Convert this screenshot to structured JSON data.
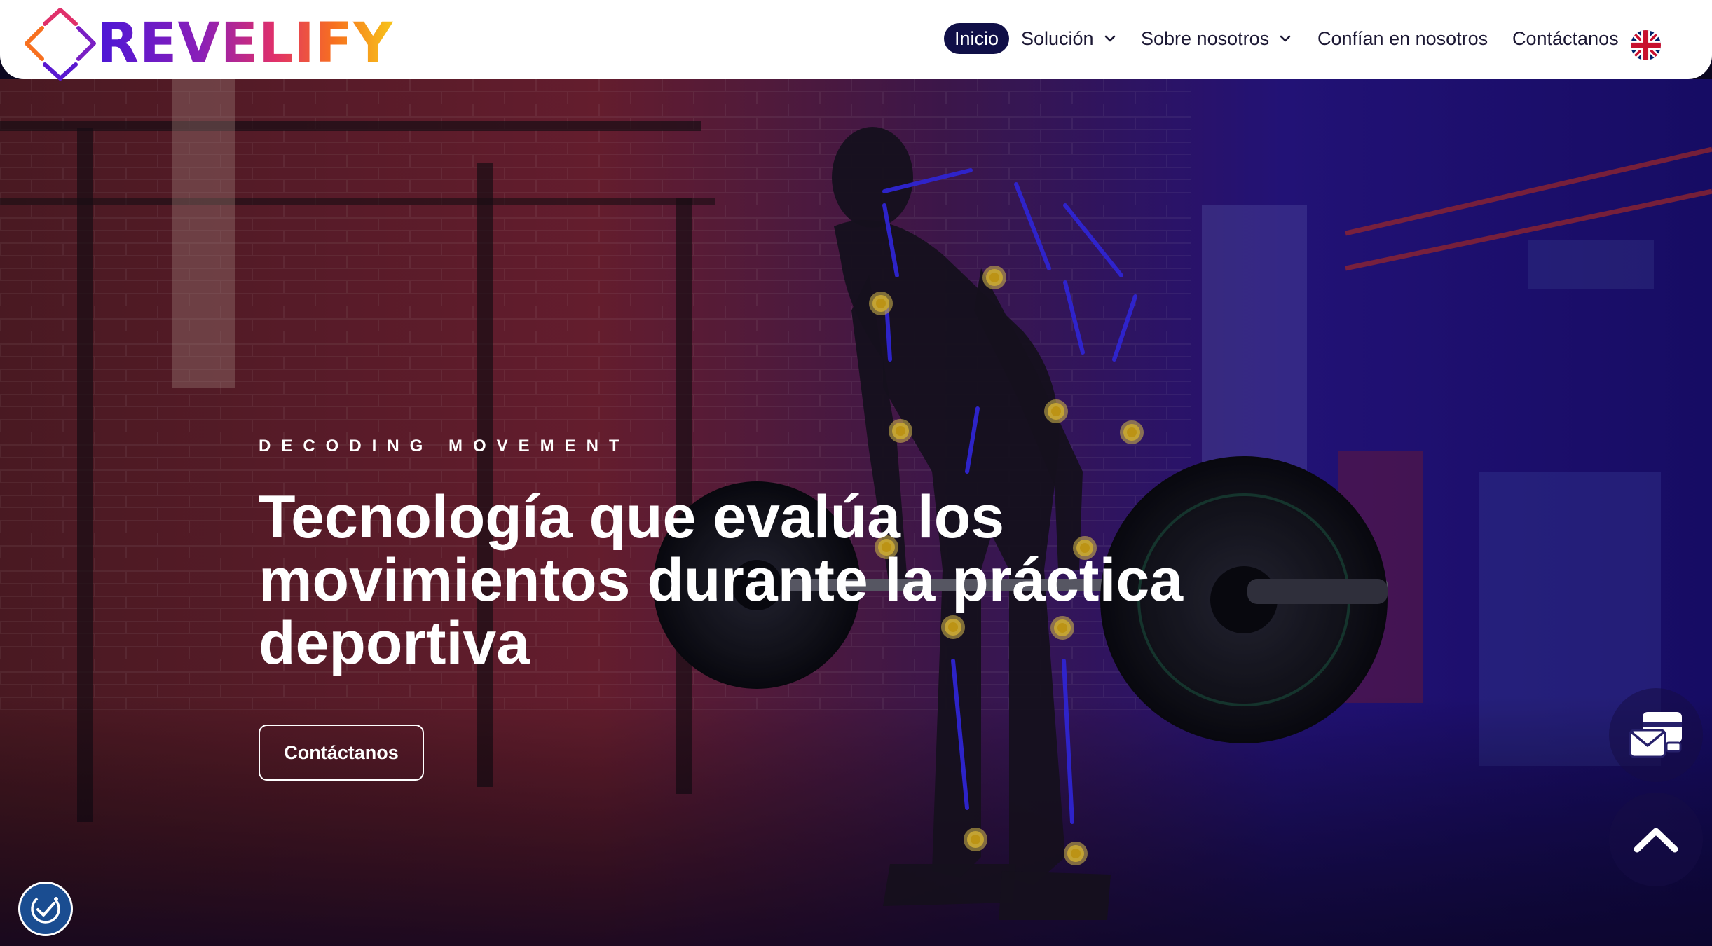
{
  "brand": {
    "name": "REVELIFY"
  },
  "nav": {
    "items": [
      {
        "label": "Inicio",
        "active": true
      },
      {
        "label": "Solución",
        "dropdown": true
      },
      {
        "label": "Sobre nosotros",
        "dropdown": true
      },
      {
        "label": "Confían en nosotros"
      },
      {
        "label": "Contáctanos"
      }
    ],
    "language_icon": "uk-flag-icon"
  },
  "hero": {
    "eyebrow": "DECODING MOVEMENT",
    "headline": "Tecnología que evalúa los movimientos durante la práctica deportiva",
    "cta_label": "Contáctanos",
    "background": "athlete-deadlift-motion-tracking-photo"
  },
  "floating": {
    "contact_icon": "envelope-wallet-icon",
    "scroll_top_icon": "chevron-up-icon",
    "accessibility_icon": "accessibility-check-icon"
  },
  "colors": {
    "brand_gradient": [
      "#4b16d6",
      "#8a1fb8",
      "#e0306a",
      "#f7701f",
      "#f7c41a"
    ],
    "nav_active_bg": "#100f47",
    "overlay_red": "#7a1f3c",
    "overlay_blue": "#2a18a8",
    "tracking_joint": "#e6b41a",
    "tracking_limb": "#3a2cff"
  }
}
